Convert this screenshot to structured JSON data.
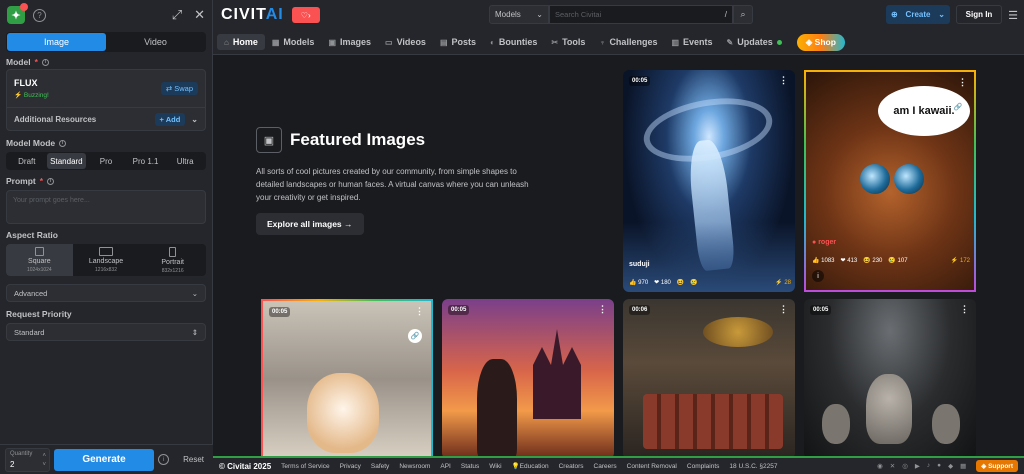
{
  "left": {
    "tabs": [
      "Image",
      "Video"
    ],
    "model_label": "Model",
    "model_name": "FLUX",
    "model_status": "Buzzing!",
    "swap": "Swap",
    "additional": "Additional Resources",
    "add": "+ Add",
    "mode_label": "Model Mode",
    "modes": [
      "Draft",
      "Standard",
      "Pro",
      "Pro 1.1",
      "Ultra"
    ],
    "prompt_label": "Prompt",
    "prompt_placeholder": "Your prompt goes here...",
    "aspect_label": "Aspect Ratio",
    "aspects": [
      {
        "name": "Square",
        "size": "1024x1024"
      },
      {
        "name": "Landscape",
        "size": "1216x832"
      },
      {
        "name": "Portrait",
        "size": "832x1216"
      }
    ],
    "advanced": "Advanced",
    "priority_label": "Request Priority",
    "priority_value": "Standard",
    "quantity_label": "Quantity",
    "quantity_value": "2",
    "generate": "Generate",
    "reset": "Reset"
  },
  "header": {
    "logo_a": "CIVIT",
    "logo_b": "AI",
    "search_type": "Models",
    "search_placeholder": "Search Civitai",
    "search_key": "/",
    "create": "Create",
    "signin": "Sign In"
  },
  "nav": [
    "Home",
    "Models",
    "Images",
    "Videos",
    "Posts",
    "Bounties",
    "Tools",
    "Challenges",
    "Events",
    "Updates"
  ],
  "shop": "Shop",
  "featured": {
    "title": "Featured Images",
    "desc": "All sorts of cool pictures created by our community, from simple shapes to detailed landscapes or human faces. A virtual canvas where you can unleash your creativity or get inspired.",
    "cta": "Explore all images →"
  },
  "tiles": {
    "t1": {
      "dur": "00:05",
      "user": "suduji",
      "s": [
        "970",
        "180",
        "",
        "",
        "28"
      ]
    },
    "t2": {
      "bubble": "am I kawaii.",
      "user": "roger",
      "s": [
        "1083",
        "413",
        "230",
        "107",
        "172"
      ]
    },
    "t3": {
      "dur": "00:05"
    },
    "t4": {
      "dur": "00:05"
    },
    "t5": {
      "dur": "00:06"
    },
    "t6": {
      "dur": "00:05"
    }
  },
  "footer": {
    "copy": "© Civitai 2025",
    "links": [
      "Terms of Service",
      "Privacy",
      "Safety",
      "Newsroom",
      "API",
      "Status",
      "Wiki",
      "💡Education",
      "Creators",
      "Careers",
      "Content Removal",
      "Complaints",
      "18 U.S.C. §2257"
    ],
    "support": "Support"
  }
}
